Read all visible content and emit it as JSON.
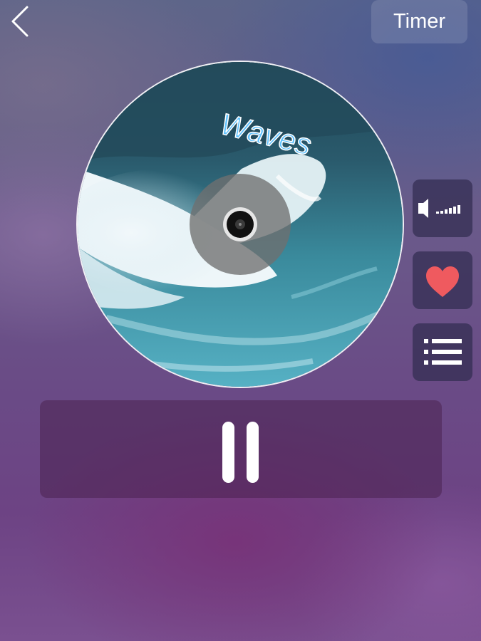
{
  "header": {
    "back_icon": "chevron-left-icon",
    "timer_label": "Timer"
  },
  "disc": {
    "title": "Waves",
    "artwork": "ocean-waves"
  },
  "side_controls": [
    {
      "name": "volume",
      "icon": "speaker-volume-icon"
    },
    {
      "name": "favorite",
      "icon": "heart-icon",
      "color": "#ef5a5f"
    },
    {
      "name": "playlist",
      "icon": "list-icon"
    }
  ],
  "playback": {
    "state": "playing",
    "control_icon": "pause-icon"
  },
  "colors": {
    "title_blue": "#5ec2ff",
    "heart_red": "#ef5a5f"
  }
}
